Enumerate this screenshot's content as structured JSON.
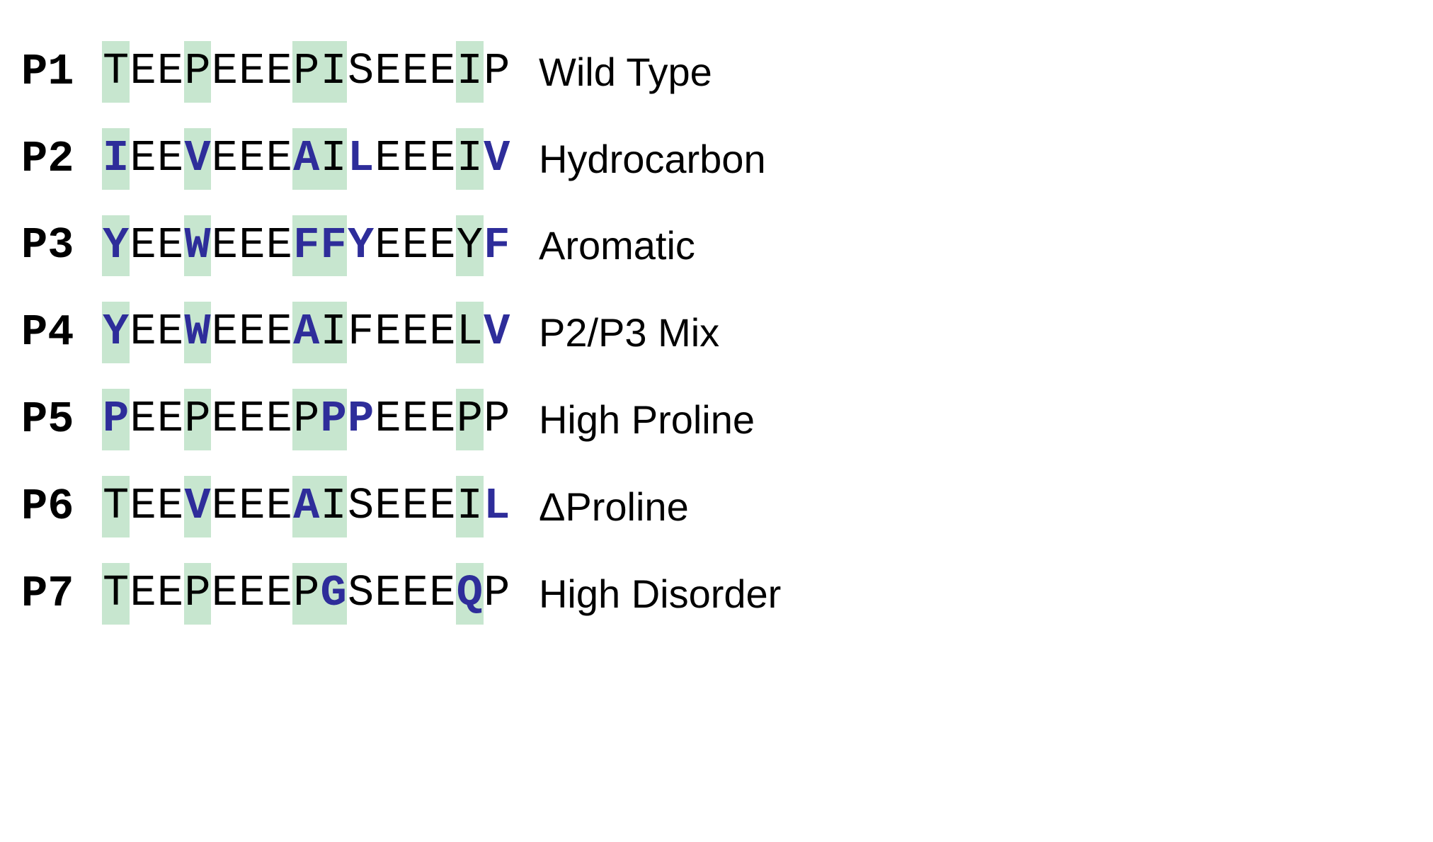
{
  "highlight_positions": [
    0,
    3,
    7,
    8,
    13
  ],
  "rows": [
    {
      "id": "P1",
      "description": "Wild Type",
      "sequence": [
        {
          "c": "T",
          "mut": false
        },
        {
          "c": "E",
          "mut": false
        },
        {
          "c": "E",
          "mut": false
        },
        {
          "c": "P",
          "mut": false
        },
        {
          "c": "E",
          "mut": false
        },
        {
          "c": "E",
          "mut": false
        },
        {
          "c": "E",
          "mut": false
        },
        {
          "c": "P",
          "mut": false
        },
        {
          "c": "I",
          "mut": false
        },
        {
          "c": "S",
          "mut": false
        },
        {
          "c": "E",
          "mut": false
        },
        {
          "c": "E",
          "mut": false
        },
        {
          "c": "E",
          "mut": false
        },
        {
          "c": "I",
          "mut": false
        },
        {
          "c": "P",
          "mut": false
        }
      ]
    },
    {
      "id": "P2",
      "description": "Hydrocarbon",
      "sequence": [
        {
          "c": "I",
          "mut": true
        },
        {
          "c": "E",
          "mut": false
        },
        {
          "c": "E",
          "mut": false
        },
        {
          "c": "V",
          "mut": true
        },
        {
          "c": "E",
          "mut": false
        },
        {
          "c": "E",
          "mut": false
        },
        {
          "c": "E",
          "mut": false
        },
        {
          "c": "A",
          "mut": true
        },
        {
          "c": "I",
          "mut": false
        },
        {
          "c": "L",
          "mut": true
        },
        {
          "c": "E",
          "mut": false
        },
        {
          "c": "E",
          "mut": false
        },
        {
          "c": "E",
          "mut": false
        },
        {
          "c": "I",
          "mut": false
        },
        {
          "c": "V",
          "mut": true
        }
      ]
    },
    {
      "id": "P3",
      "description": "Aromatic",
      "sequence": [
        {
          "c": "Y",
          "mut": true
        },
        {
          "c": "E",
          "mut": false
        },
        {
          "c": "E",
          "mut": false
        },
        {
          "c": "W",
          "mut": true
        },
        {
          "c": "E",
          "mut": false
        },
        {
          "c": "E",
          "mut": false
        },
        {
          "c": "E",
          "mut": false
        },
        {
          "c": "F",
          "mut": true
        },
        {
          "c": "F",
          "mut": true
        },
        {
          "c": "Y",
          "mut": true
        },
        {
          "c": "E",
          "mut": false
        },
        {
          "c": "E",
          "mut": false
        },
        {
          "c": "E",
          "mut": false
        },
        {
          "c": "Y",
          "mut": false
        },
        {
          "c": "F",
          "mut": true
        }
      ]
    },
    {
      "id": "P4",
      "description": "P2/P3 Mix",
      "sequence": [
        {
          "c": "Y",
          "mut": true
        },
        {
          "c": "E",
          "mut": false
        },
        {
          "c": "E",
          "mut": false
        },
        {
          "c": "W",
          "mut": true
        },
        {
          "c": "E",
          "mut": false
        },
        {
          "c": "E",
          "mut": false
        },
        {
          "c": "E",
          "mut": false
        },
        {
          "c": "A",
          "mut": true
        },
        {
          "c": "I",
          "mut": false
        },
        {
          "c": "F",
          "mut": false
        },
        {
          "c": "E",
          "mut": false
        },
        {
          "c": "E",
          "mut": false
        },
        {
          "c": "E",
          "mut": false
        },
        {
          "c": "L",
          "mut": false
        },
        {
          "c": "V",
          "mut": true
        }
      ]
    },
    {
      "id": "P5",
      "description": "High Proline",
      "sequence": [
        {
          "c": "P",
          "mut": true
        },
        {
          "c": "E",
          "mut": false
        },
        {
          "c": "E",
          "mut": false
        },
        {
          "c": "P",
          "mut": false
        },
        {
          "c": "E",
          "mut": false
        },
        {
          "c": "E",
          "mut": false
        },
        {
          "c": "E",
          "mut": false
        },
        {
          "c": "P",
          "mut": false
        },
        {
          "c": "P",
          "mut": true
        },
        {
          "c": "P",
          "mut": true
        },
        {
          "c": "E",
          "mut": false
        },
        {
          "c": "E",
          "mut": false
        },
        {
          "c": "E",
          "mut": false
        },
        {
          "c": "P",
          "mut": false
        },
        {
          "c": "P",
          "mut": false
        }
      ]
    },
    {
      "id": "P6",
      "description": "ΔProline",
      "sequence": [
        {
          "c": "T",
          "mut": false
        },
        {
          "c": "E",
          "mut": false
        },
        {
          "c": "E",
          "mut": false
        },
        {
          "c": "V",
          "mut": true
        },
        {
          "c": "E",
          "mut": false
        },
        {
          "c": "E",
          "mut": false
        },
        {
          "c": "E",
          "mut": false
        },
        {
          "c": "A",
          "mut": true
        },
        {
          "c": "I",
          "mut": false
        },
        {
          "c": "S",
          "mut": false
        },
        {
          "c": "E",
          "mut": false
        },
        {
          "c": "E",
          "mut": false
        },
        {
          "c": "E",
          "mut": false
        },
        {
          "c": "I",
          "mut": false
        },
        {
          "c": "L",
          "mut": true
        }
      ]
    },
    {
      "id": "P7",
      "description": "High Disorder",
      "sequence": [
        {
          "c": "T",
          "mut": false
        },
        {
          "c": "E",
          "mut": false
        },
        {
          "c": "E",
          "mut": false
        },
        {
          "c": "P",
          "mut": false
        },
        {
          "c": "E",
          "mut": false
        },
        {
          "c": "E",
          "mut": false
        },
        {
          "c": "E",
          "mut": false
        },
        {
          "c": "P",
          "mut": false
        },
        {
          "c": "G",
          "mut": true
        },
        {
          "c": "S",
          "mut": false
        },
        {
          "c": "E",
          "mut": false
        },
        {
          "c": "E",
          "mut": false
        },
        {
          "c": "E",
          "mut": false
        },
        {
          "c": "Q",
          "mut": true
        },
        {
          "c": "P",
          "mut": false
        }
      ]
    }
  ]
}
